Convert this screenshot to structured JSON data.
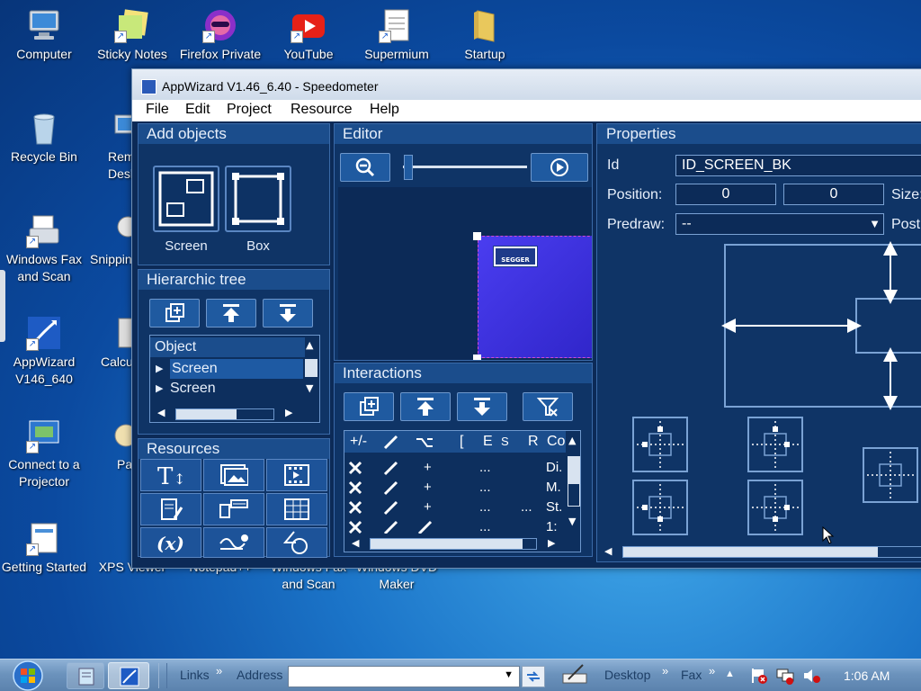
{
  "desktop": {
    "icons": [
      {
        "label": "Computer"
      },
      {
        "label": "Sticky Notes"
      },
      {
        "label": "Firefox Private"
      },
      {
        "label": "YouTube"
      },
      {
        "label": "Supermium"
      },
      {
        "label": "Startup"
      },
      {
        "label": "Recycle Bin"
      },
      {
        "label": "Remote Desktop"
      },
      {
        "label": "Windows Fax and Scan"
      },
      {
        "label": "Snipping"
      },
      {
        "label": "AppWizard V146_640"
      },
      {
        "label": "Calcu"
      },
      {
        "label": "Connect to a Projector"
      },
      {
        "label": "Pa"
      },
      {
        "label": "Getting Started"
      },
      {
        "label": "XPS Viewer"
      },
      {
        "label": "Notepad++"
      },
      {
        "label": "Windows Fax and Scan"
      },
      {
        "label": "Windows DVD Maker"
      }
    ]
  },
  "window": {
    "title": "AppWizard V1.46_6.40 - Speedometer",
    "menu": [
      "File",
      "Edit",
      "Project",
      "Resource",
      "Help"
    ]
  },
  "add_objects": {
    "title": "Add objects",
    "items": [
      {
        "label": "Screen"
      },
      {
        "label": "Box"
      }
    ]
  },
  "tree": {
    "title": "Hierarchic tree",
    "column": "Object",
    "rows": [
      {
        "label": "Screen"
      },
      {
        "label": "Screen"
      }
    ]
  },
  "resources": {
    "title": "Resources"
  },
  "editor": {
    "title": "Editor",
    "zoom_level": 0.05,
    "canvas_logo": "SEGGER"
  },
  "interactions": {
    "title": "Interactions",
    "columns": [
      "+/-",
      "",
      "",
      "[",
      "E",
      "S",
      "R",
      "Co"
    ],
    "rows": [
      {
        "expr": "+",
        "e": "...",
        "s": "",
        "co": "Di."
      },
      {
        "expr": "+",
        "e": "...",
        "s": "",
        "co": "M."
      },
      {
        "expr": "+",
        "e": "...",
        "s": "...",
        "co": "St."
      },
      {
        "expr": "",
        "e": "...",
        "s": "",
        "co": "1:"
      }
    ]
  },
  "properties": {
    "title": "Properties",
    "id_label": "Id",
    "id_value": "ID_SCREEN_BK",
    "position_label": "Position:",
    "pos_x": "0",
    "pos_y": "0",
    "size_label": "Size:",
    "predraw_label": "Predraw:",
    "predraw_value": "--",
    "post_label": "Post"
  },
  "taskbar": {
    "links": "Links",
    "address": "Address",
    "desktop": "Desktop",
    "fax": "Fax",
    "clock": "1:06 AM"
  },
  "colors": {
    "panel_bg": "#0f3466",
    "panel_head": "#1b4d8c",
    "accent_border": "#6d97cc",
    "canvas_screen": "#3a2fe0"
  }
}
